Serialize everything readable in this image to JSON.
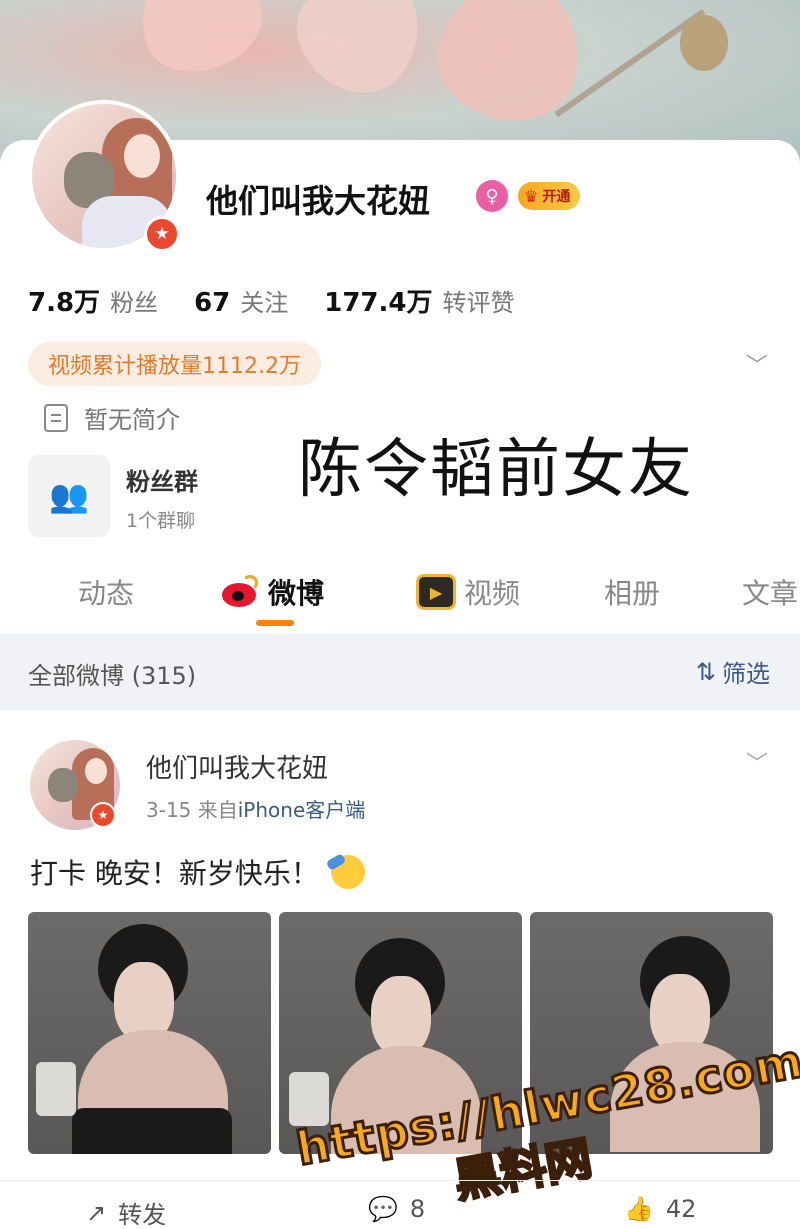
{
  "profile": {
    "name": "他们叫我大花妞",
    "vip_label": "开通",
    "stats": [
      {
        "num": "7.8万",
        "label": "粉丝"
      },
      {
        "num": "67",
        "label": "关注"
      },
      {
        "num": "177.4万",
        "label": "转评赞"
      }
    ],
    "views_pill": "视频累计播放量1112.2万",
    "intro": "暂无简介",
    "fan_group": {
      "title": "粉丝群",
      "sub": "1个群聊"
    }
  },
  "overlay_title": "陈令韬前女友",
  "tabs": [
    {
      "label": "动态",
      "active": false
    },
    {
      "label": "微博",
      "active": true
    },
    {
      "label": "视频",
      "active": false
    },
    {
      "label": "相册",
      "active": false
    },
    {
      "label": "文章",
      "active": false
    }
  ],
  "filter": {
    "count_label": "全部微博 (315)",
    "button_label": "筛选"
  },
  "post": {
    "author": "他们叫我大花妞",
    "date": "3-15",
    "source_prefix": "来自",
    "source": "iPhone客户端",
    "text": "打卡 晚安！新岁快乐！",
    "actions": {
      "repost": "转发",
      "comments": "8",
      "likes": "42"
    }
  },
  "watermark": {
    "url": "https://hlwc28.com",
    "name": "黑料网"
  },
  "colors": {
    "accent": "#ff8200",
    "link": "#3a5a8a",
    "views_pill_text": "#e07c2c",
    "weibo_red": "#e6162d"
  }
}
